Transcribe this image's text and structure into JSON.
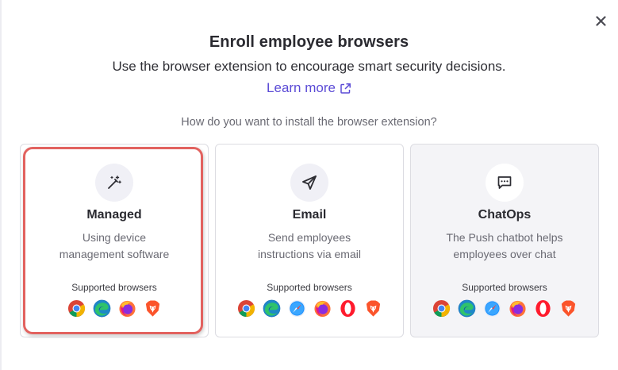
{
  "dialog": {
    "title": "Enroll employee browsers",
    "subtitle": "Use the browser extension to encourage smart security decisions.",
    "learn_more": "Learn more",
    "question": "How do you want to install the browser extension?",
    "close_icon": "close-icon",
    "accent_color": "#5b4bd6",
    "selection_color": "#e2625f"
  },
  "cards": [
    {
      "id": "managed",
      "title": "Managed",
      "desc_line1": "Using device",
      "desc_line2": "management software",
      "supported_label": "Supported browsers",
      "icon": "magic-wand-icon",
      "selected": true,
      "browsers": [
        "chrome",
        "edge",
        "firefox",
        "brave"
      ]
    },
    {
      "id": "email",
      "title": "Email",
      "desc_line1": "Send employees",
      "desc_line2": "instructions via email",
      "supported_label": "Supported browsers",
      "icon": "paper-plane-icon",
      "selected": false,
      "browsers": [
        "chrome",
        "edge",
        "safari",
        "firefox",
        "opera",
        "brave"
      ]
    },
    {
      "id": "chatops",
      "title": "ChatOps",
      "desc_line1": "The Push chatbot helps",
      "desc_line2": "employees over chat",
      "supported_label": "Supported browsers",
      "icon": "chat-bubble-icon",
      "selected": false,
      "browsers": [
        "chrome",
        "edge",
        "safari",
        "firefox",
        "opera",
        "brave"
      ]
    }
  ]
}
